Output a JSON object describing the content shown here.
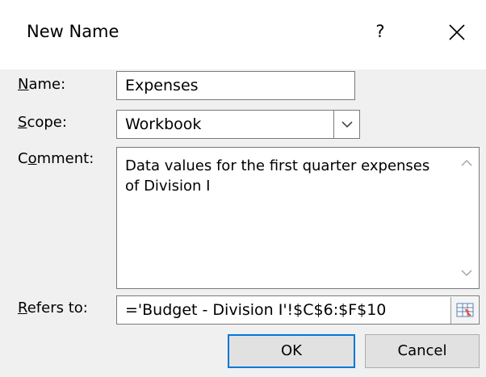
{
  "dialog": {
    "title": "New Name",
    "help_label": "?",
    "close_label": "✕"
  },
  "fields": {
    "name": {
      "label_key": "N",
      "label_rest": "ame:",
      "value": "Expenses"
    },
    "scope": {
      "label_key": "S",
      "label_rest": "cope:",
      "value": "Workbook"
    },
    "comment": {
      "label_pre": "C",
      "label_key": "o",
      "label_rest": "mment:",
      "value": "Data values for the first quarter expenses of Division I"
    },
    "refers_to": {
      "label_key": "R",
      "label_rest": "efers to:",
      "value": "='Budget - Division I'!$C$6:$F$10"
    }
  },
  "buttons": {
    "ok": "OK",
    "cancel": "Cancel"
  },
  "icons": {
    "dropdown": "chevron-down-icon",
    "scroll_up": "chevron-up-icon",
    "scroll_down": "chevron-down-icon",
    "range_picker": "collapse-dialog-icon"
  }
}
